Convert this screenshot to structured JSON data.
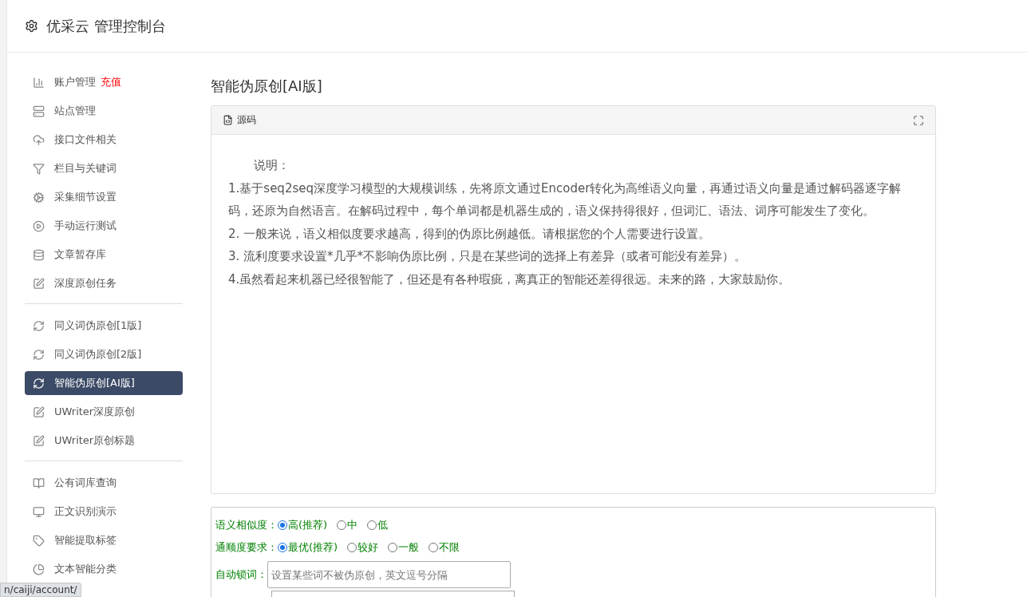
{
  "header": {
    "title": "优采云 管理控制台"
  },
  "sidebar": {
    "groups": [
      {
        "items": [
          {
            "label": "账户管理",
            "badge": "充值",
            "kind": "chart",
            "selected": false
          },
          {
            "label": "站点管理",
            "kind": "server",
            "selected": false
          },
          {
            "label": "接口文件相关",
            "kind": "cloud",
            "selected": false
          },
          {
            "label": "栏目与关键词",
            "kind": "filter",
            "selected": false
          },
          {
            "label": "采集细节设置",
            "kind": "cogs",
            "selected": false
          },
          {
            "label": "手动运行测试",
            "kind": "play",
            "selected": false
          },
          {
            "label": "文章暂存库",
            "kind": "database",
            "selected": false
          },
          {
            "label": "深度原创任务",
            "kind": "edit",
            "selected": false
          }
        ]
      },
      {
        "items": [
          {
            "label": "同义词伪原创[1版]",
            "kind": "refresh",
            "selected": false
          },
          {
            "label": "同义词伪原创[2版]",
            "kind": "refresh",
            "selected": false
          },
          {
            "label": "智能伪原创[AI版]",
            "kind": "refresh",
            "selected": true
          },
          {
            "label": "UWriter深度原创",
            "kind": "edit",
            "selected": false
          },
          {
            "label": "UWriter原创标题",
            "kind": "edit",
            "selected": false
          }
        ]
      },
      {
        "items": [
          {
            "label": "公有词库查询",
            "kind": "book",
            "selected": false
          },
          {
            "label": "正文识别演示",
            "kind": "monitor",
            "selected": false
          },
          {
            "label": "智能提取标签",
            "kind": "tag",
            "selected": false
          },
          {
            "label": "文本智能分类",
            "kind": "pie",
            "selected": false
          }
        ]
      }
    ]
  },
  "page_title": "智能伪原创[AI版]",
  "editor": {
    "toolbar_label": "源码",
    "lines": [
      "说明：",
      "1.基于seq2seq深度学习模型的大规模训练，先将原文通过Encoder转化为高维语义向量，再通过语义向量是通过解码器逐字解码，还原为自然语言。在解码过程中，每个单词都是机器生成的，语义保持得很好，但词汇、语法、词序可能发生了变化。",
      "2. 一般来说，语义相似度要求越高，得到的伪原比例越低。请根据您的个人需要进行设置。",
      "3. 流利度要求设置*几乎*不影响伪原比例，只是在某些词的选择上有差异（或者可能没有差异）。",
      "4.虽然看起来机器已经很智能了，但还是有各种瑕疵，离真正的智能还差得很远。未来的路，大家鼓励你。"
    ]
  },
  "options": [
    {
      "label": "语义相似度：",
      "choices": [
        {
          "label": "高(推荐)",
          "selected": true
        },
        {
          "label": "中",
          "selected": false
        },
        {
          "label": "低",
          "selected": false
        }
      ]
    },
    {
      "label": "通顺度要求：",
      "choices": [
        {
          "label": "最优(推荐)",
          "selected": true
        },
        {
          "label": "较好",
          "selected": false
        },
        {
          "label": "一般",
          "selected": false
        },
        {
          "label": "不限",
          "selected": false
        }
      ]
    }
  ],
  "lock_words": {
    "label": "自动锁词：",
    "placeholder": "设置某些词不被伪原创，英文逗号分隔"
  },
  "status_url": "n/caiji/account/"
}
